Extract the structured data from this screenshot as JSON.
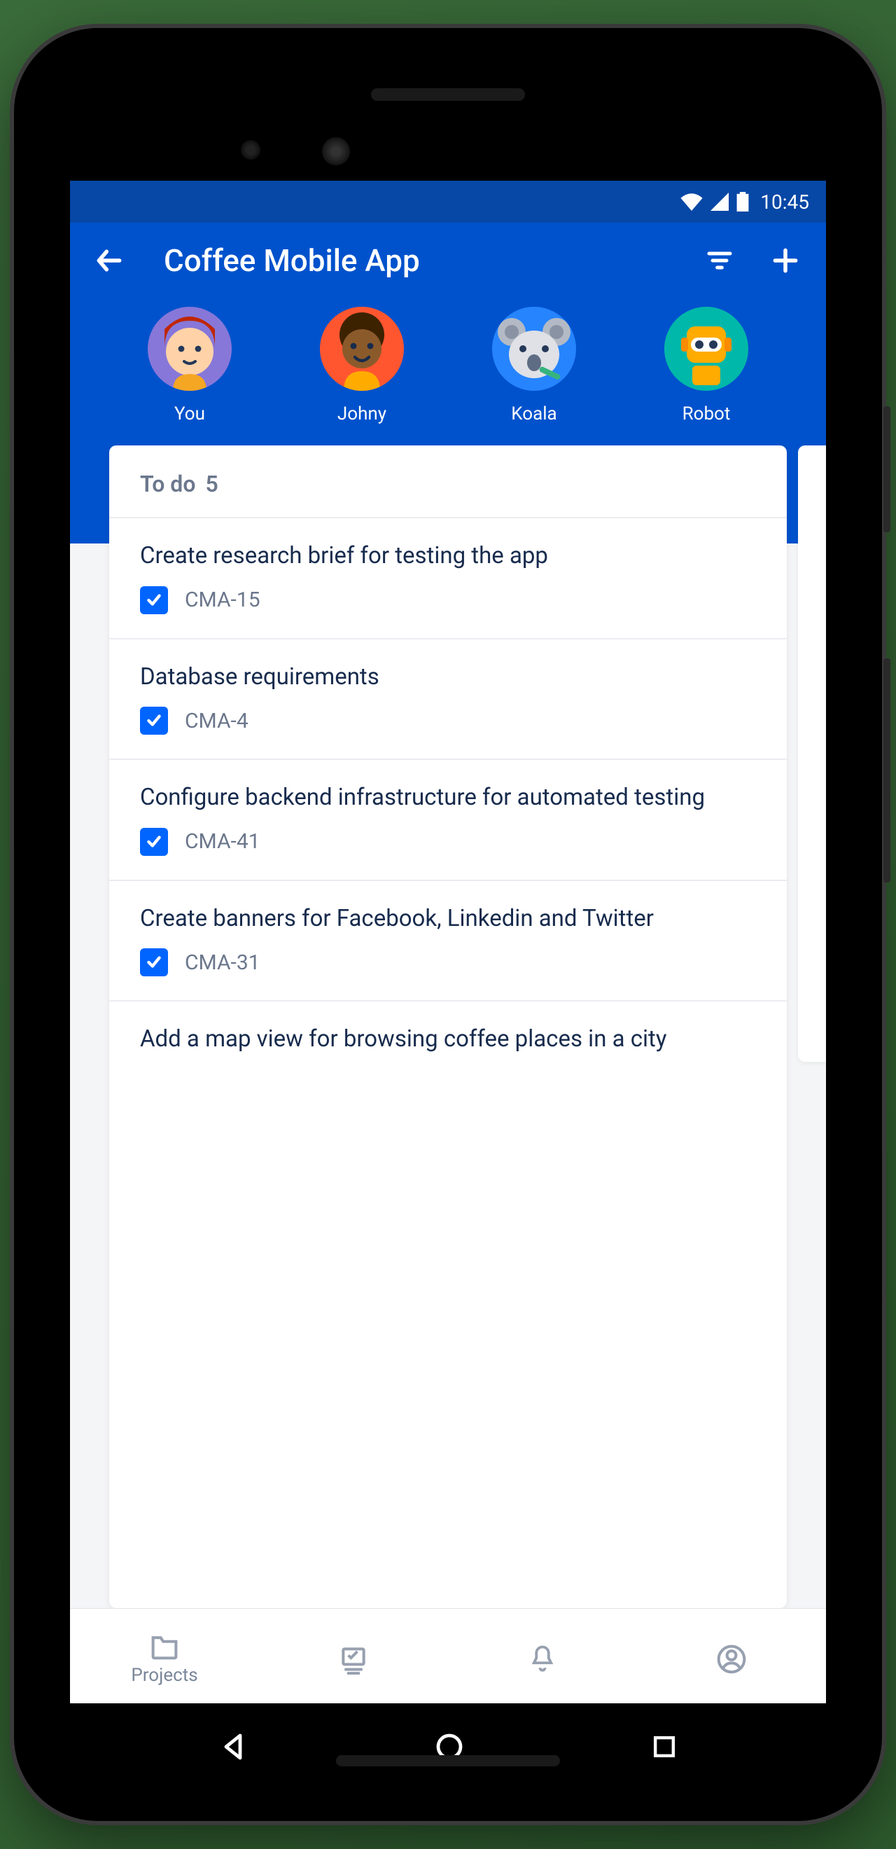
{
  "status": {
    "time": "10:45"
  },
  "header": {
    "title": "Coffee Mobile App",
    "avatars": [
      {
        "label": "You",
        "bg": "#8777d9"
      },
      {
        "label": "Johny",
        "bg": "#ff5630"
      },
      {
        "label": "Koala",
        "bg": "#2684ff"
      },
      {
        "label": "Robot",
        "bg": "#00b8a9"
      }
    ]
  },
  "column": {
    "name": "To do",
    "count": "5",
    "cards": [
      {
        "title": "Create research brief for testing the app",
        "key": "CMA-15"
      },
      {
        "title": "Database requirements",
        "key": "CMA-4"
      },
      {
        "title": "Configure backend infrastructure for automated testing",
        "key": "CMA-41"
      },
      {
        "title": "Create banners for Facebook, Linkedin and Twitter",
        "key": "CMA-31"
      },
      {
        "title": "Add a map view for browsing coffee places in a city",
        "key": ""
      }
    ]
  },
  "tabs": {
    "projects": "Projects"
  },
  "colors": {
    "primary": "#0052cc",
    "primaryDark": "#0747a6",
    "accent": "#0065ff",
    "text": "#172b4d",
    "muted": "#6b778c"
  }
}
